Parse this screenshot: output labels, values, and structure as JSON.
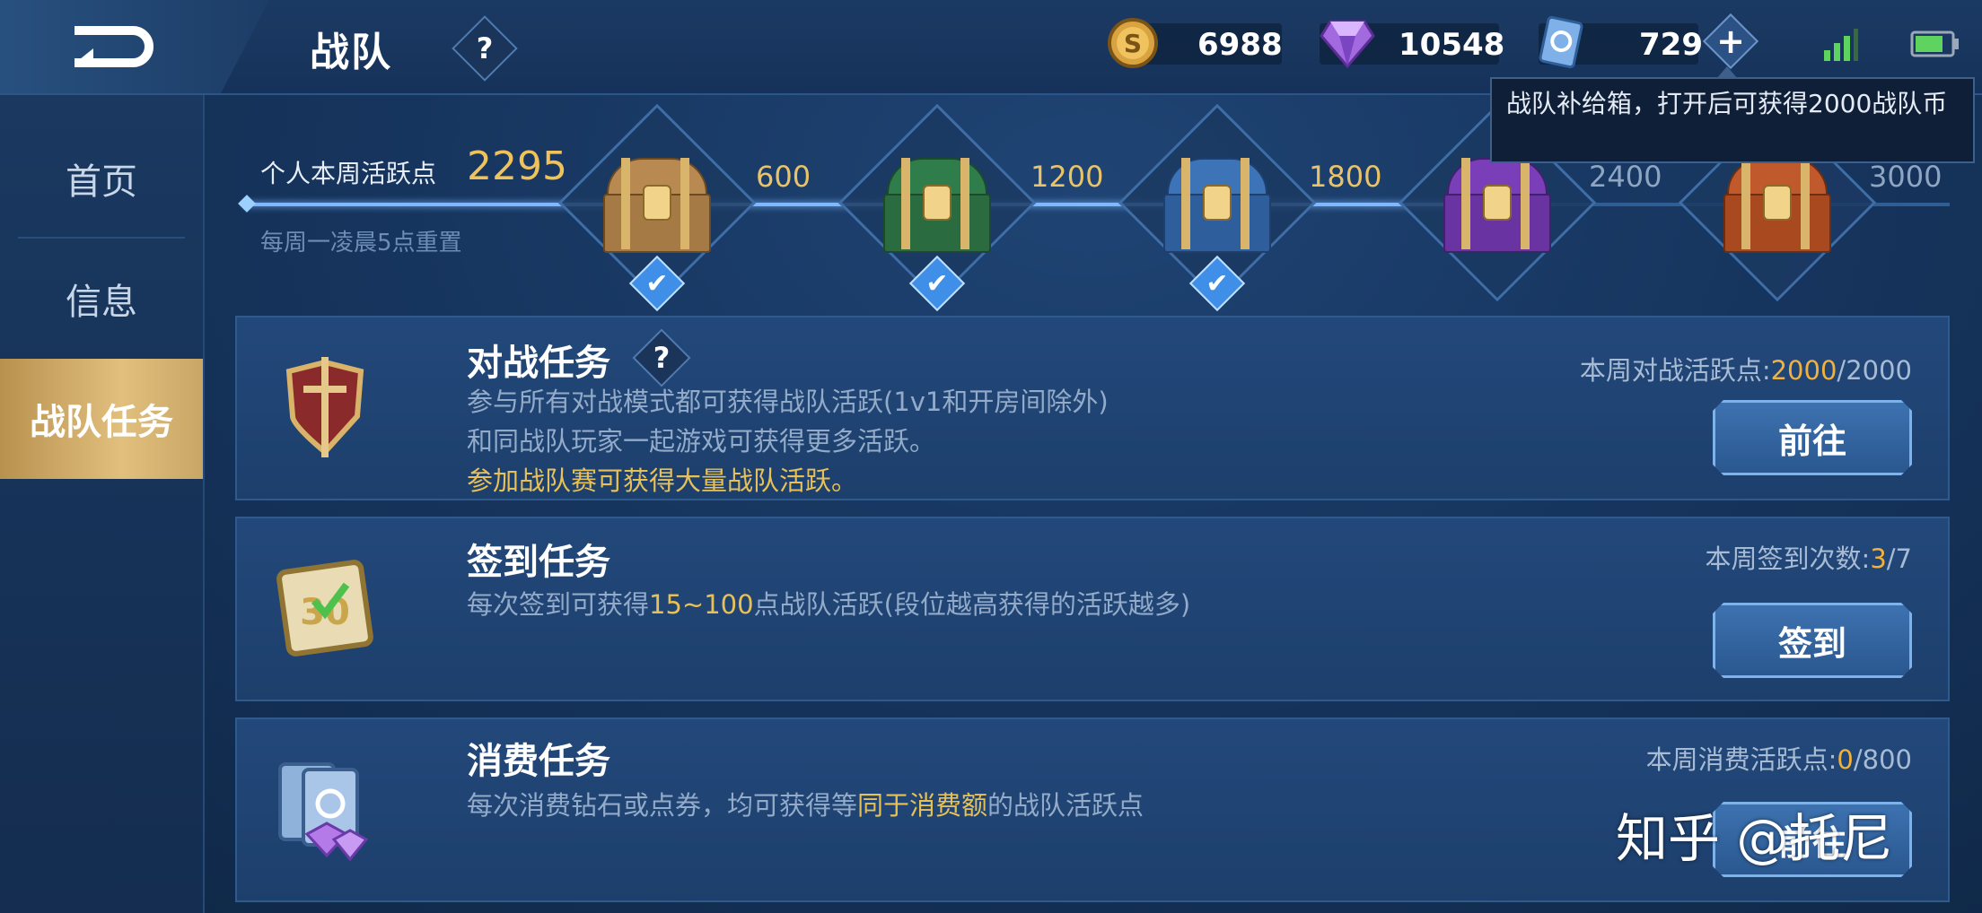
{
  "header": {
    "title": "战队",
    "help": "?",
    "currencies": {
      "gold": "6988",
      "diamond": "10548",
      "coupon": "729"
    },
    "plus": "+"
  },
  "sidebar": {
    "items": [
      {
        "label": "首页"
      },
      {
        "label": "信息"
      },
      {
        "label": "战队任务"
      }
    ]
  },
  "progress": {
    "label": "个人本周活跃点",
    "value": "2295",
    "reset_note": "每周一凌晨5点重置",
    "fill_fraction": 0.765,
    "thresholds": [
      "600",
      "1200",
      "1800",
      "2400",
      "3000"
    ],
    "claimed": [
      "✔",
      "✔",
      "✔"
    ]
  },
  "tooltip": {
    "text": "战队补给箱，打开后可获得2000战队币"
  },
  "tasks": [
    {
      "title": "对战任务",
      "help": "?",
      "desc_line1": "参与所有对战模式都可获得战队活跃(1v1和开房间除外)",
      "desc_line2": "和同战队玩家一起游戏可获得更多活跃。",
      "desc_highlight": "参加战队赛可获得大量战队活跃。",
      "stat_label": "本周对战活跃点:",
      "stat_current": "2000",
      "stat_total": "/2000",
      "button": "前往"
    },
    {
      "title": "签到任务",
      "desc_pre": "每次签到可获得",
      "desc_hl": "15~100",
      "desc_post": "点战队活跃(段位越高获得的活跃越多)",
      "stat_label": "本周签到次数:",
      "stat_current": "3",
      "stat_total": "/7",
      "button": "签到"
    },
    {
      "title": "消费任务",
      "desc_pre": "每次消费钻石或点券，均可获得等",
      "desc_hl": "同于消费额",
      "desc_post": "的战队活跃点",
      "stat_label": "本周消费活跃点:",
      "stat_current": "0",
      "stat_total": "/800",
      "button": "前往"
    }
  ],
  "watermark": "知乎 @托尼"
}
